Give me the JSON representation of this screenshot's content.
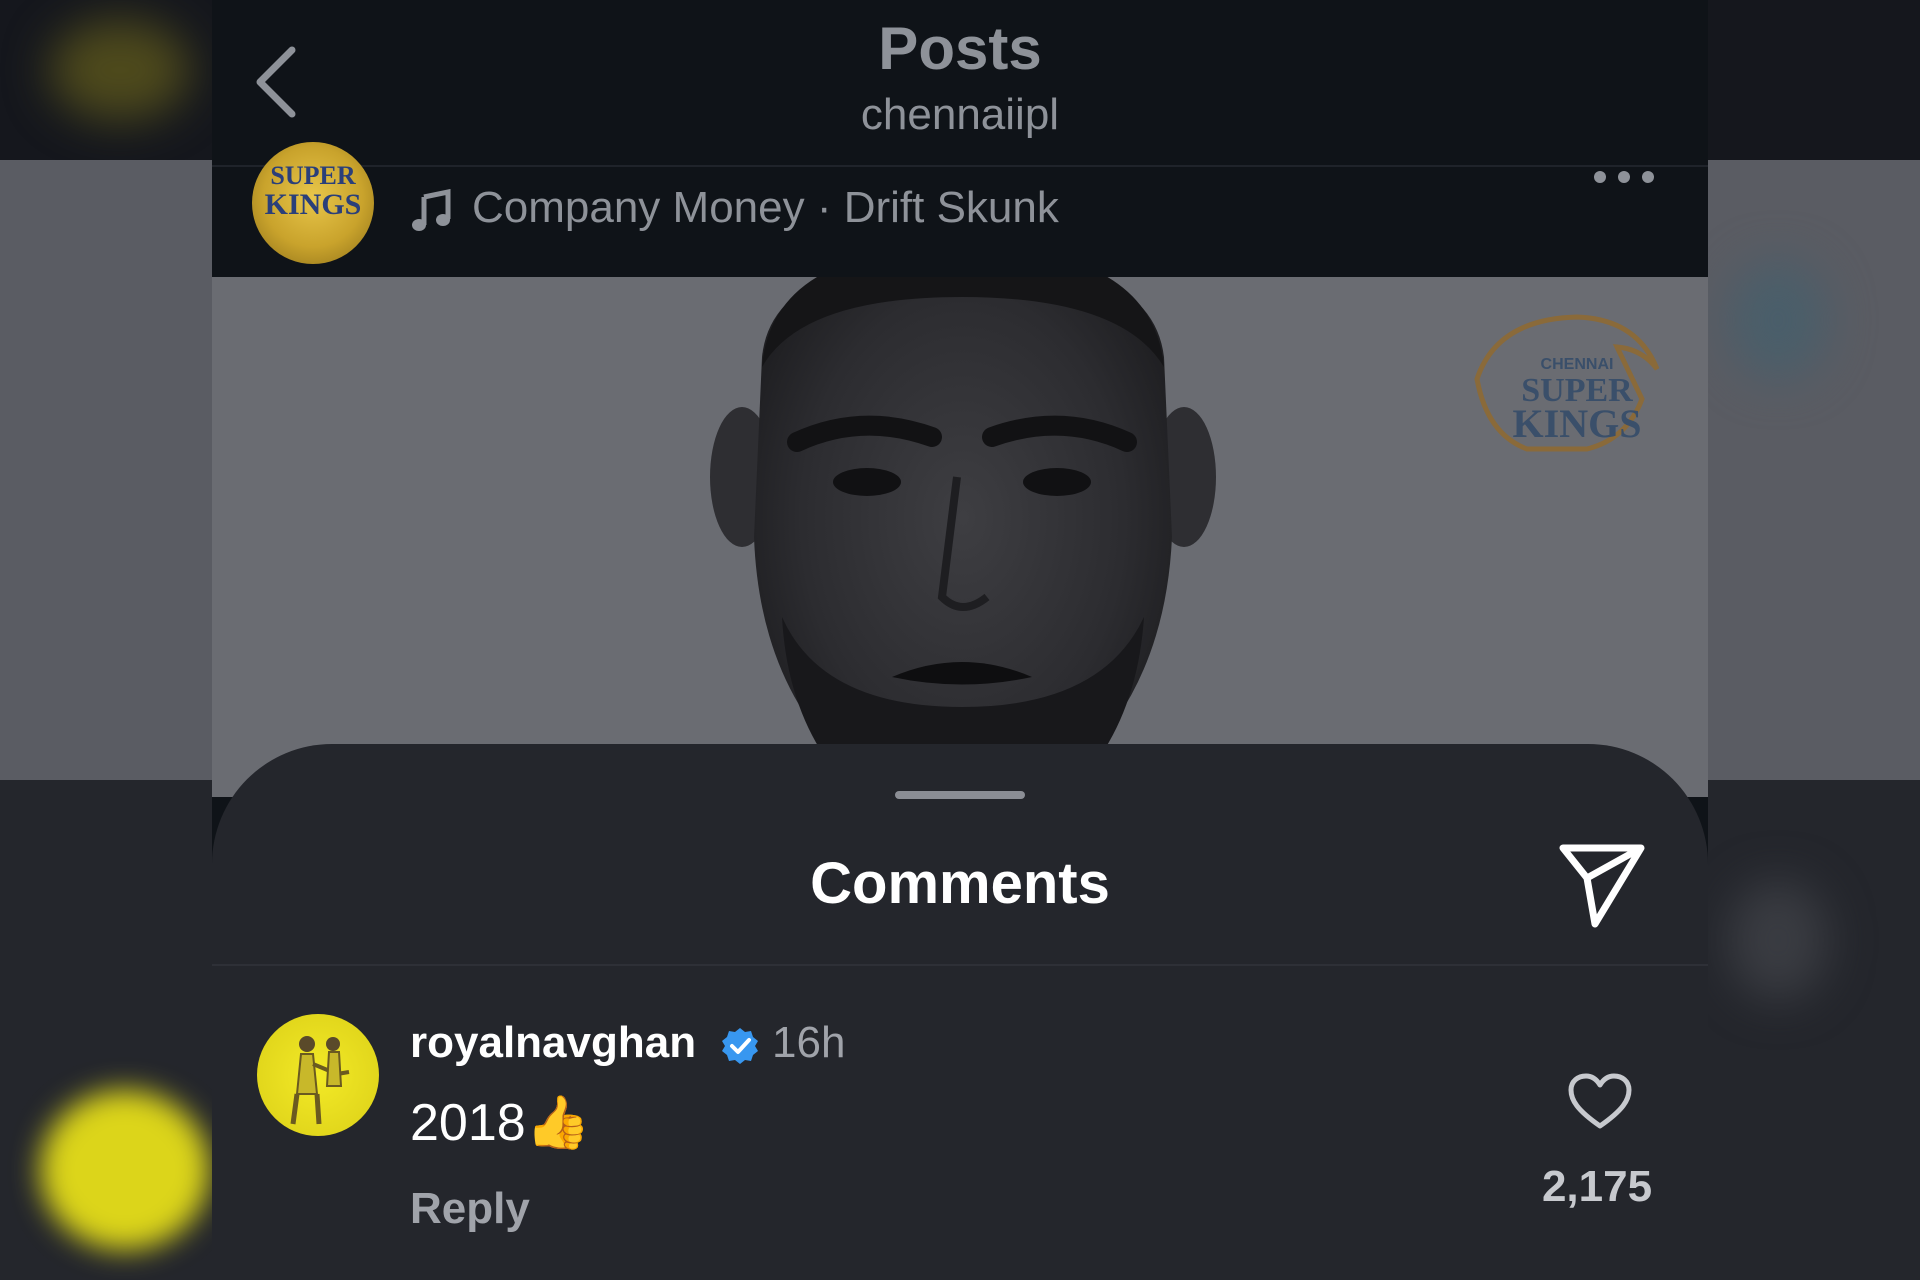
{
  "header": {
    "title": "Posts",
    "subtitle": "chennaiipl",
    "back_icon": "chevron-left-icon"
  },
  "post": {
    "avatar_logo_line1": "SUPER",
    "avatar_logo_line2": "KINGS",
    "music_icon": "music-note-icon",
    "audio_label": "Company Money · Drift Skunk",
    "more_icon": "ellipsis-icon",
    "watermark_logo": "CHENNAI SUPER KINGS"
  },
  "comments_sheet": {
    "title": "Comments",
    "share_icon": "paper-plane-icon",
    "comments": [
      {
        "username": "royalnavghan",
        "verified": true,
        "time": "16h",
        "text": "2018👍",
        "reply_label": "Reply",
        "likes": "2,175"
      }
    ]
  },
  "colors": {
    "sheet_bg": "#24262c",
    "header_bg": "#0f1318",
    "verified": "#3897f0",
    "avatar_yellow": "#f3ea27"
  }
}
